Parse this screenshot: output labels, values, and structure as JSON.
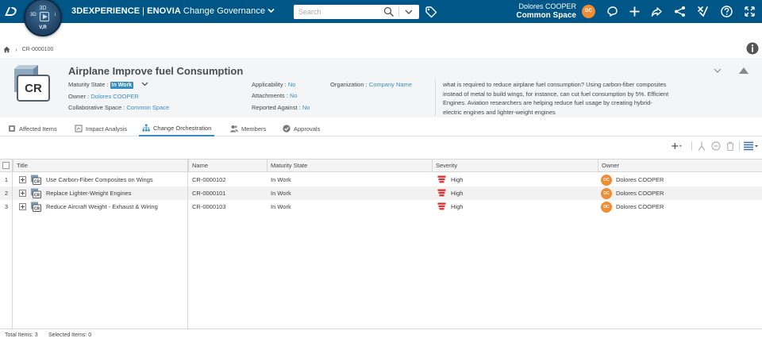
{
  "topbar": {
    "brand_bold": "3DEXPERIENCE",
    "brand_sep": "|",
    "brand_product": "ENOVIA",
    "app_name": "Change Governance",
    "compass_top": "3D",
    "compass_vr": "V,R",
    "compass_3d": "3D",
    "compass_i": "i",
    "search_placeholder": "Search",
    "user_name": "Dolores COOPER",
    "collab_space": "Common Space",
    "user_initials": "DC"
  },
  "breadcrumb": {
    "items": [
      "CR-0000100"
    ]
  },
  "header": {
    "icon_label": "CR",
    "title": "Airplane Improve fuel Consumption",
    "maturity_label": "Maturity State :",
    "maturity_value": "In Work",
    "owner_label": "Owner :",
    "owner_value": "Dolores COOPER",
    "space_label": "Collaborative Space :",
    "space_value": "Common Space",
    "applicability_label": "Applicability :",
    "applicability_value": "No",
    "attachments_label": "Attachments :",
    "attachments_value": "No",
    "reported_label": "Reported Against :",
    "reported_value": "No",
    "org_label": "Organization :",
    "org_value": "Company Name",
    "description": "what is required to reduce airplane fuel consumption? Using carbon-fiber composites instead of metal to build wings, for instance, can cut fuel consumption by 5%. Efficient Engines. Aviation researchers are helping reduce fuel usage by creating hybrid-electric engines and lighter-weight engines"
  },
  "tabs": [
    {
      "label": "Affected Items"
    },
    {
      "label": "Impact Analysis"
    },
    {
      "label": "Change Orchestration"
    },
    {
      "label": "Members"
    },
    {
      "label": "Approvals"
    }
  ],
  "grid": {
    "columns": [
      "Title",
      "Name",
      "Maturity State",
      "Severity",
      "Owner"
    ],
    "rows": [
      {
        "num": "1",
        "title": "Use Carbon-Fiber Composites on Wings",
        "name": "CR-0000102",
        "state": "In Work",
        "severity": "High",
        "owner": "Dolores COOPER",
        "owner_initials": "DC"
      },
      {
        "num": "2",
        "title": "Replace Lighter-Weight Engines",
        "name": "CR-0000101",
        "state": "In Work",
        "severity": "High",
        "owner": "Dolores COOPER",
        "owner_initials": "DC"
      },
      {
        "num": "3",
        "title": "Reduce Aircraft Weight - Exhaust & Wiring",
        "name": "CR-0000103",
        "state": "In Work",
        "severity": "High",
        "owner": "Dolores COOPER",
        "owner_initials": "DC"
      }
    ]
  },
  "footer": {
    "total": "Total Items: 3",
    "selected": "Selected Items: 0"
  },
  "colors": {
    "topbar": "#005686",
    "accent": "#368ec4",
    "avatar": "#f08c34",
    "severity_high": "#e02e2e"
  }
}
